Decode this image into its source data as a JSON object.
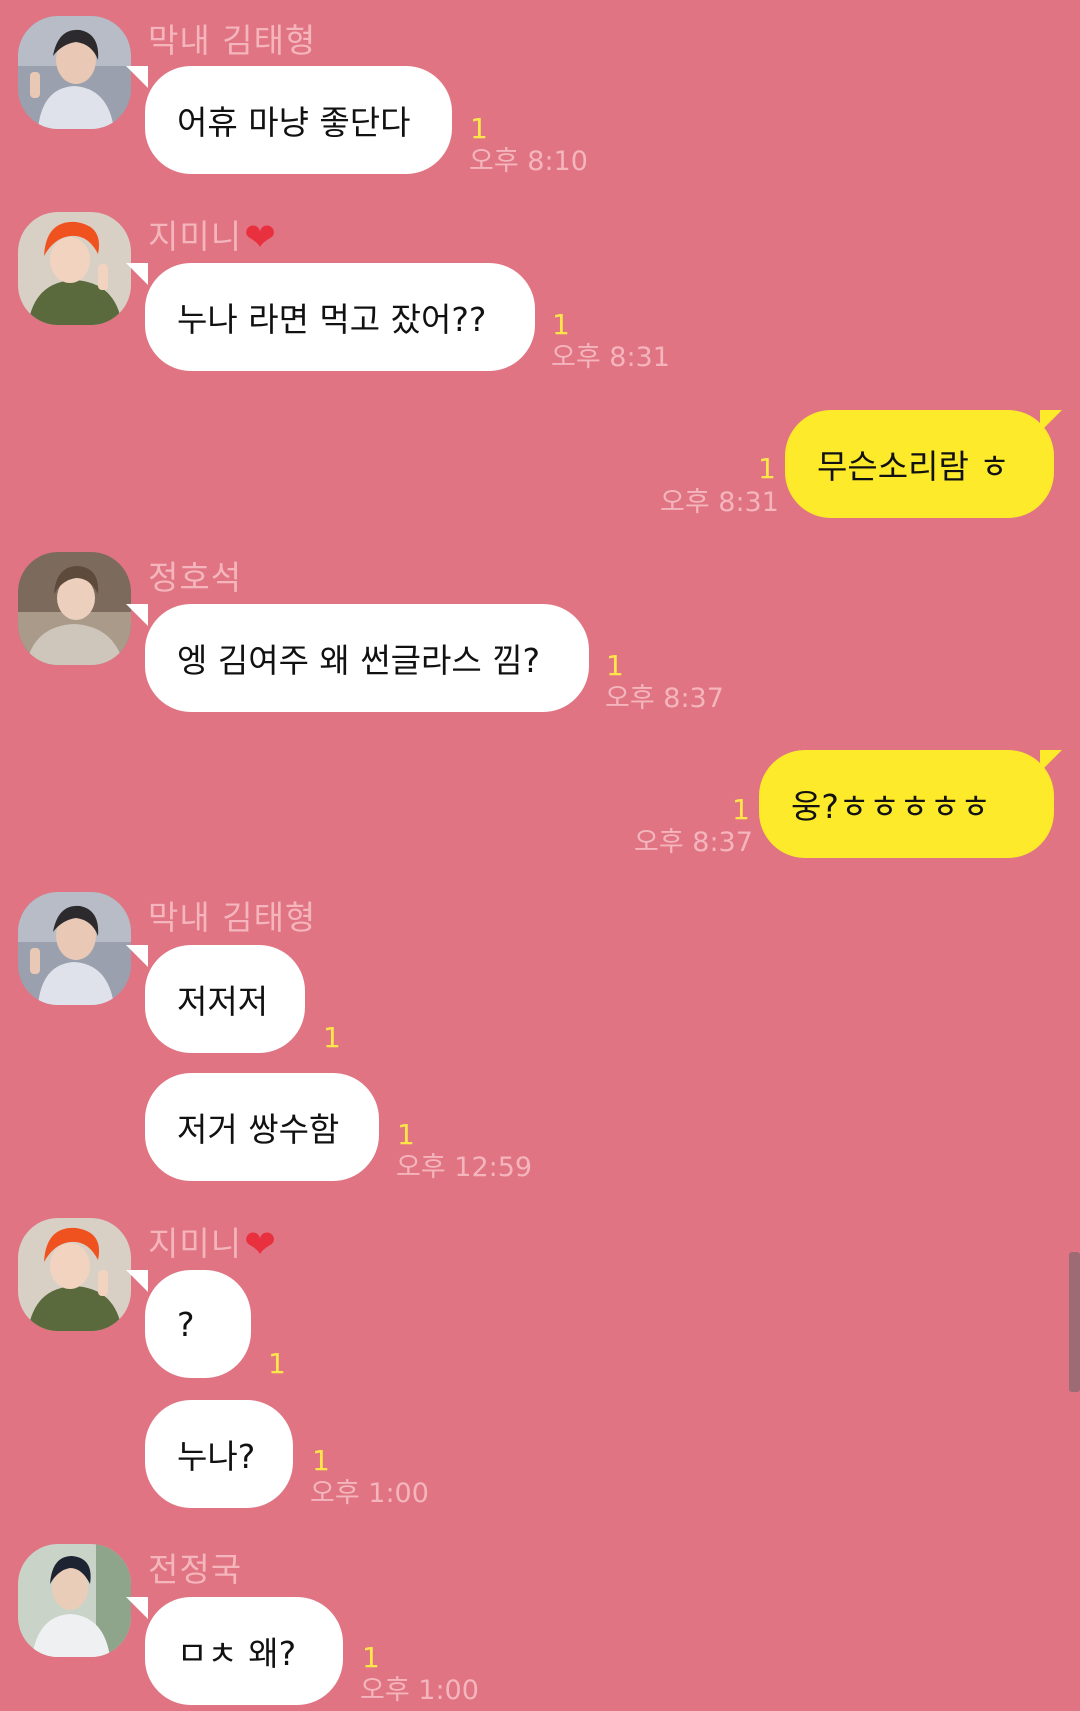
{
  "colors": {
    "background": "#e07483",
    "incoming_bubble": "#ffffff",
    "outgoing_bubble": "#fcea2b",
    "unread_count": "#fde64a",
    "sender_name": "#f4b5bd"
  },
  "messages": [
    {
      "sender": "막내 김태형",
      "text": "어휴 마냥 좋단다",
      "unread": "1",
      "time": "오후 8:10"
    },
    {
      "sender": "지미니",
      "sender_icon": "heart-icon",
      "text": "누나 라면 먹고 잤어??",
      "unread": "1",
      "time": "오후 8:31"
    },
    {
      "sender": "me",
      "text": "무슨소리람 ㅎ",
      "unread": "1",
      "time": "오후 8:31"
    },
    {
      "sender": "정호석",
      "text": "엥 김여주 왜 썬글라스 낌?",
      "unread": "1",
      "time": "오후 8:37"
    },
    {
      "sender": "me",
      "text": "웅?ㅎㅎㅎㅎㅎ",
      "unread": "1",
      "time": "오후 8:37"
    },
    {
      "sender": "막내 김태형",
      "text": "저저저",
      "unread": "1"
    },
    {
      "sender": "막내 김태형",
      "text": "저거 쌍수함",
      "unread": "1",
      "time": "오후 12:59"
    },
    {
      "sender": "지미니",
      "sender_icon": "heart-icon",
      "text": "?",
      "unread": "1"
    },
    {
      "sender": "지미니",
      "text": "누나?",
      "unread": "1",
      "time": "오후 1:00"
    },
    {
      "sender": "전정국",
      "text": "ㅁㅊ 왜?",
      "unread": "1",
      "time": "오후 1:00"
    }
  ]
}
